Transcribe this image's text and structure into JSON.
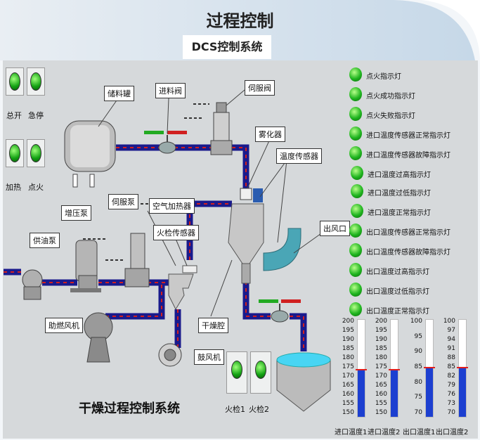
{
  "header": {
    "title": "过程控制",
    "subtitle": "DCS控制系统"
  },
  "left_lamps": [
    {
      "label": "总开",
      "mark_top": "ST",
      "mark_bot": "STJ"
    },
    {
      "label": "急停",
      "mark_top": "ST",
      "mark_bot": "STJ"
    },
    {
      "label": "加热",
      "mark_top": "ST",
      "mark_bot": "STJ"
    },
    {
      "label": "点火",
      "mark_top": "ST",
      "mark_bot": "STJ"
    }
  ],
  "equipment": {
    "storage_tank": "储料罐",
    "feed_valve": "进料阀",
    "servo_valve": "伺服阀",
    "atomizer": "雾化器",
    "temp_sensor": "温度传感器",
    "boost_pump": "增压泵",
    "servo_pump": "伺服泵",
    "air_heater": "空气加热器",
    "fire_sensor": "火检传感器",
    "oil_pump": "供油泵",
    "outlet": "出风口",
    "dry_tower": "干燥腔",
    "combustion_fan": "助燃风机",
    "blower": "鼓风机",
    "fire_check_1": "火检1",
    "fire_check_2": "火检2",
    "system_title": "干燥过程控制系统"
  },
  "indicators": [
    "点火指示灯",
    "点火成功指示灯",
    "点火失败指示灯",
    "进口温度传感器正常指示灯",
    "进口温度传感器故障指示灯",
    "进口温度过高指示灯",
    "进口温度过低指示灯",
    "进口温度正常指示灯",
    "出口温度传感器正常指示灯",
    "出口温度传感器故障指示灯",
    "出口温度过高指示灯",
    "出口温度过低指示灯",
    "出口温度正常指示灯"
  ],
  "gauges": [
    {
      "label": "进口温度1",
      "ticks": [
        "200",
        "195",
        "190",
        "185",
        "180",
        "175",
        "170",
        "165",
        "160",
        "155",
        "150"
      ],
      "min": 150,
      "max": 200,
      "value": 174
    },
    {
      "label": "进口温度2",
      "ticks": [
        "200",
        "195",
        "190",
        "185",
        "180",
        "175",
        "170",
        "165",
        "160",
        "155",
        "150"
      ],
      "min": 150,
      "max": 200,
      "value": 174
    },
    {
      "label": "出口温度1",
      "ticks": [
        "100",
        "95",
        "90",
        "85",
        "80",
        "75",
        "70"
      ],
      "min": 70,
      "max": 100,
      "value": 85
    },
    {
      "label": "出口温度2",
      "ticks": [
        "100",
        "97",
        "94",
        "91",
        "88",
        "85",
        "82",
        "79",
        "76",
        "73",
        "70"
      ],
      "min": 70,
      "max": 100,
      "value": 85
    }
  ],
  "colors": {
    "panel": "#d6d9db",
    "pipe": "#1a1a8c",
    "dash": "#d02020",
    "fill": "#1c3fd0",
    "lamp": "#1fb41f"
  }
}
